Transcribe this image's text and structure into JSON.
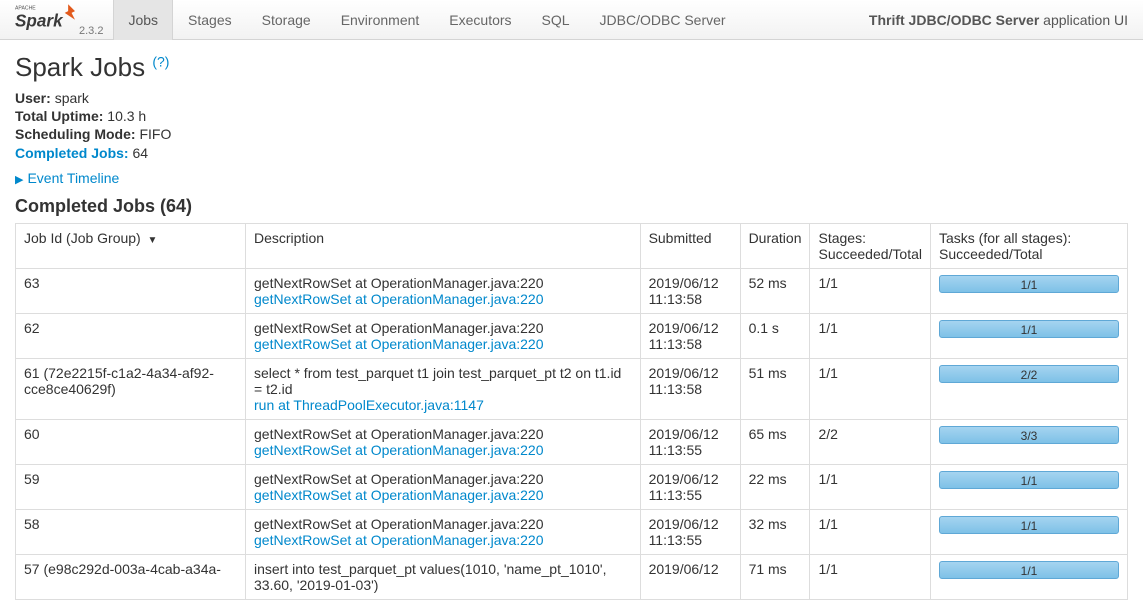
{
  "version": "2.3.2",
  "nav": {
    "items": [
      "Jobs",
      "Stages",
      "Storage",
      "Environment",
      "Executors",
      "SQL",
      "JDBC/ODBC Server"
    ],
    "activeIndex": 0
  },
  "appName": "Thrift JDBC/ODBC Server",
  "appSuffix": " application UI",
  "pageTitle": "Spark Jobs",
  "helpMark": "(?)",
  "meta": {
    "userLabel": "User:",
    "user": "spark",
    "uptimeLabel": "Total Uptime:",
    "uptime": "10.3 h",
    "schedLabel": "Scheduling Mode:",
    "sched": "FIFO",
    "completedLabel": "Completed Jobs:",
    "completed": "64"
  },
  "eventTimeline": "Event Timeline",
  "sectionTitle": "Completed Jobs (64)",
  "columns": {
    "jobId": "Job Id (Job Group)",
    "desc": "Description",
    "submitted": "Submitted",
    "duration": "Duration",
    "stages": "Stages: Succeeded/Total",
    "tasks": "Tasks (for all stages): Succeeded/Total"
  },
  "rows": [
    {
      "id": "63",
      "desc": "getNextRowSet at OperationManager.java:220",
      "link": "getNextRowSet at OperationManager.java:220",
      "sub": "2019/06/12 11:13:58",
      "dur": "52 ms",
      "stg": "1/1",
      "tsk": "1/1"
    },
    {
      "id": "62",
      "desc": "getNextRowSet at OperationManager.java:220",
      "link": "getNextRowSet at OperationManager.java:220",
      "sub": "2019/06/12 11:13:58",
      "dur": "0.1 s",
      "stg": "1/1",
      "tsk": "1/1"
    },
    {
      "id": "61 (72e2215f-c1a2-4a34-af92-cce8ce40629f)",
      "desc": "select * from test_parquet t1 join test_parquet_pt t2 on t1.id = t2.id",
      "link": "run at ThreadPoolExecutor.java:1147",
      "sub": "2019/06/12 11:13:58",
      "dur": "51 ms",
      "stg": "1/1",
      "tsk": "2/2"
    },
    {
      "id": "60",
      "desc": "getNextRowSet at OperationManager.java:220",
      "link": "getNextRowSet at OperationManager.java:220",
      "sub": "2019/06/12 11:13:55",
      "dur": "65 ms",
      "stg": "2/2",
      "tsk": "3/3"
    },
    {
      "id": "59",
      "desc": "getNextRowSet at OperationManager.java:220",
      "link": "getNextRowSet at OperationManager.java:220",
      "sub": "2019/06/12 11:13:55",
      "dur": "22 ms",
      "stg": "1/1",
      "tsk": "1/1"
    },
    {
      "id": "58",
      "desc": "getNextRowSet at OperationManager.java:220",
      "link": "getNextRowSet at OperationManager.java:220",
      "sub": "2019/06/12 11:13:55",
      "dur": "32 ms",
      "stg": "1/1",
      "tsk": "1/1"
    },
    {
      "id": "57 (e98c292d-003a-4cab-a34a-",
      "desc": "insert into test_parquet_pt values(1010, 'name_pt_1010', 33.60, '2019-01-03')",
      "link": "",
      "sub": "2019/06/12",
      "dur": "71 ms",
      "stg": "1/1",
      "tsk": "1/1"
    }
  ]
}
